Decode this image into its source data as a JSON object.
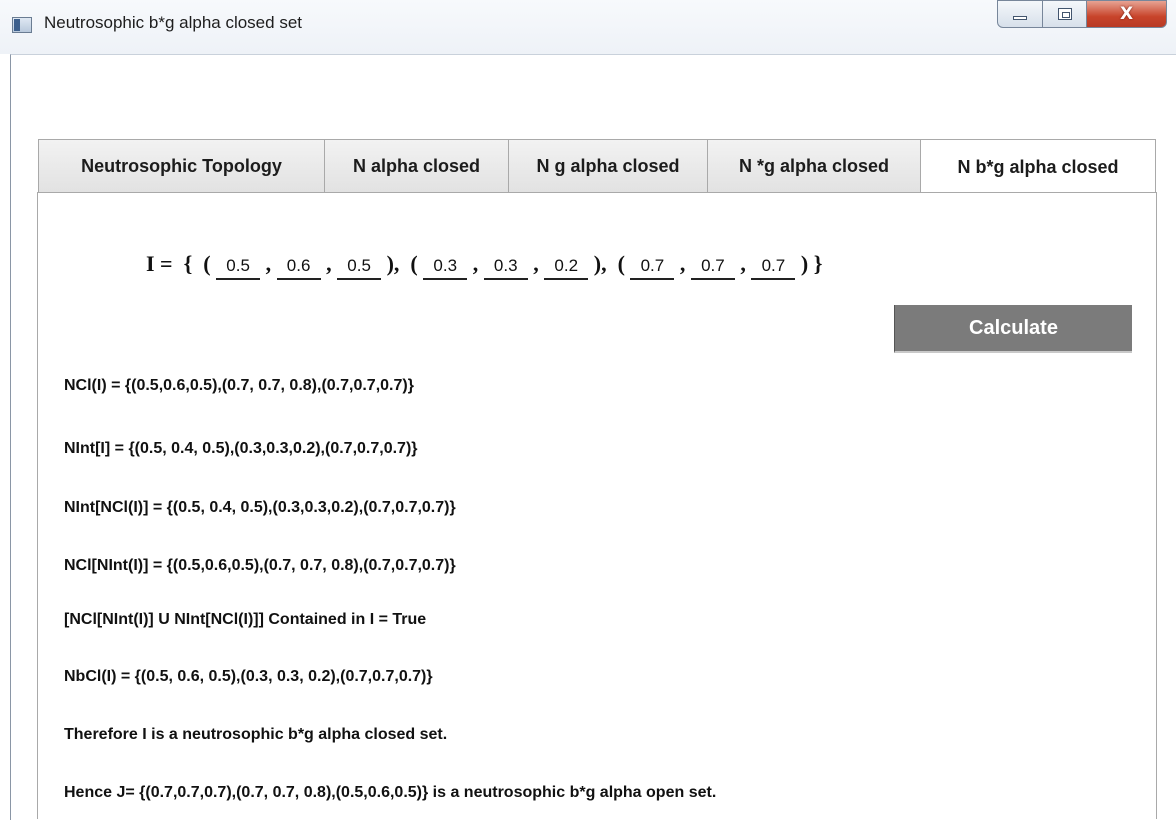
{
  "window": {
    "title": "Neutrosophic b*g alpha closed set",
    "close_glyph": "X"
  },
  "tabs": [
    {
      "label": "Neutrosophic Topology"
    },
    {
      "label": "N alpha closed"
    },
    {
      "label": "N g alpha closed"
    },
    {
      "label": "N *g alpha closed"
    },
    {
      "label": "N b*g alpha closed",
      "selected": true
    }
  ],
  "set_input": {
    "prefix": "I =  {  (",
    "triples": [
      [
        "0.5",
        "0.6",
        "0.5"
      ],
      [
        "0.3",
        "0.3",
        "0.2"
      ],
      [
        "0.7",
        "0.7",
        "0.7"
      ]
    ],
    "separator": " , ",
    "close_paren": " )",
    "triple_separator": ",  (",
    "suffix": " }"
  },
  "calculate_button": {
    "label": "Calculate"
  },
  "results": [
    "NCl(I) = {(0.5,0.6,0.5),(0.7, 0.7, 0.8),(0.7,0.7,0.7)}",
    "NInt[I] = {(0.5, 0.4, 0.5),(0.3,0.3,0.2),(0.7,0.7,0.7)}",
    "NInt[NCl(I)] = {(0.5, 0.4, 0.5),(0.3,0.3,0.2),(0.7,0.7,0.7)}",
    "NCl[NInt(I)] = {(0.5,0.6,0.5),(0.7, 0.7, 0.8),(0.7,0.7,0.7)}",
    "[NCl[NInt(I)] U NInt[NCl(I)]] Contained in I = True",
    "NbCl(I) = {(0.5, 0.6, 0.5),(0.3, 0.3, 0.2),(0.7,0.7,0.7)}",
    "Therefore I is a neutrosophic b*g alpha closed set.",
    "Hence J= {(0.7,0.7,0.7),(0.7, 0.7, 0.8),(0.5,0.6,0.5)} is a neutrosophic b*g alpha open set."
  ]
}
